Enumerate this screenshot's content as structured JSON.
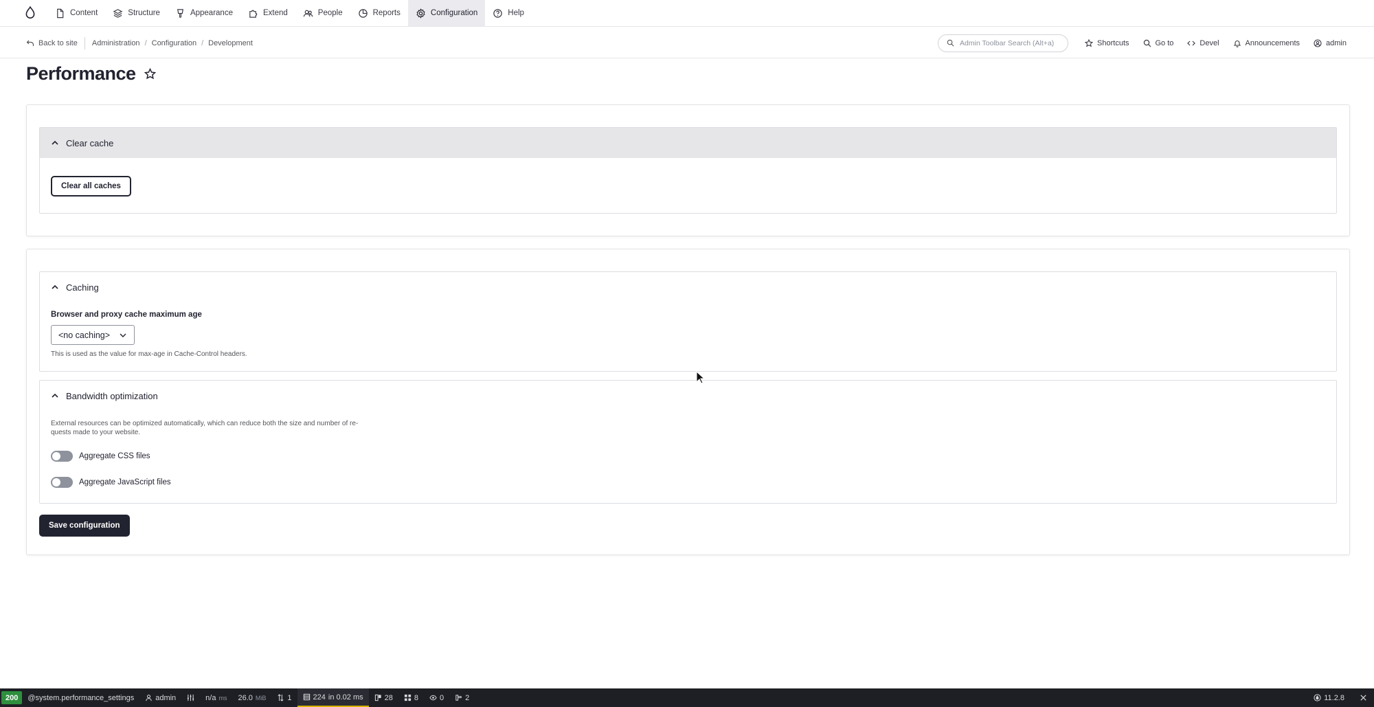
{
  "toolbar": {
    "items": [
      {
        "label": "Content",
        "icon": "file-icon"
      },
      {
        "label": "Structure",
        "icon": "layers-icon"
      },
      {
        "label": "Appearance",
        "icon": "brush-icon"
      },
      {
        "label": "Extend",
        "icon": "puzzle-icon"
      },
      {
        "label": "People",
        "icon": "people-icon"
      },
      {
        "label": "Reports",
        "icon": "chart-pie-icon"
      },
      {
        "label": "Configuration",
        "icon": "gear-icon",
        "active": true
      },
      {
        "label": "Help",
        "icon": "help-circle-icon"
      }
    ]
  },
  "secondary": {
    "back_label": "Back to site",
    "breadcrumb": [
      "Administration",
      "Configuration",
      "Development"
    ],
    "search_placeholder": "Admin Toolbar Search (Alt+a)",
    "shortcuts": "Shortcuts",
    "goto": "Go to",
    "devel": "Devel",
    "announcements": "Announcements",
    "user": "admin"
  },
  "page": {
    "title": "Performance"
  },
  "clear_cache": {
    "heading": "Clear cache",
    "button": "Clear all caches"
  },
  "caching": {
    "heading": "Caching",
    "field_label": "Browser and proxy cache maximum age",
    "selected": "<no caching>",
    "description": "This is used as the value for max-age in Cache-Control headers."
  },
  "bandwidth": {
    "heading": "Bandwidth optimization",
    "description_line1": "External resources can be optimized automatically, which can reduce both the size and number of re-",
    "description_line2": "quests made to your website.",
    "css_label": "Aggregate CSS files",
    "js_label": "Aggregate JavaScript files",
    "css_enabled": false,
    "js_enabled": false
  },
  "actions": {
    "save": "Save configuration"
  },
  "debug": {
    "status": "200",
    "route": "@system.performance_settings",
    "user": "admin",
    "time_value": "n/a",
    "time_unit": "ms",
    "memory_value": "26.0",
    "memory_unit": "MiB",
    "requests": "1",
    "db_count": "224",
    "db_time": "in 0.02 ms",
    "cache": "28",
    "blocks": "8",
    "views": "0",
    "theme": "2",
    "php_version": "11.2.8"
  },
  "colors": {
    "text": "#222330",
    "status_ok": "#2e8f3e",
    "debug_bg": "#1e1f24",
    "active_nav_bg": "#ebebef"
  }
}
